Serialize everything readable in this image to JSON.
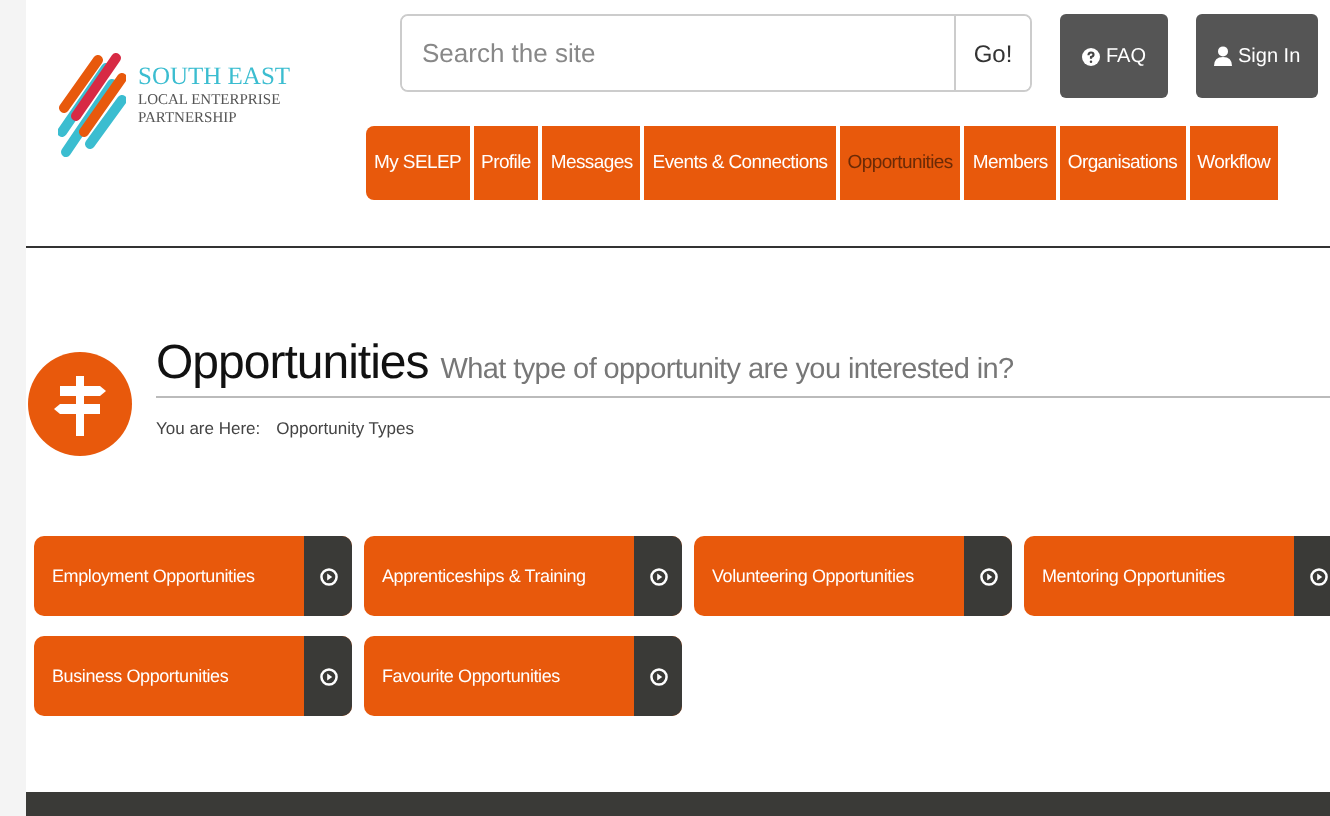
{
  "logo": {
    "line1": "SOUTH EAST",
    "line2": "LOCAL ENTERPRISE",
    "line3": "PARTNERSHIP"
  },
  "search": {
    "placeholder": "Search the site",
    "button": "Go!"
  },
  "header_buttons": [
    {
      "label": "FAQ",
      "kind": "help"
    },
    {
      "label": "Sign In",
      "kind": "user"
    }
  ],
  "nav": [
    {
      "label": "My SELEP",
      "selected": false
    },
    {
      "label": "Profile",
      "selected": false
    },
    {
      "label": "Messages",
      "selected": false
    },
    {
      "label": "Events & Connections",
      "selected": false
    },
    {
      "label": "Opportunities",
      "selected": true
    },
    {
      "label": "Members",
      "selected": false
    },
    {
      "label": "Organisations",
      "selected": false
    },
    {
      "label": "Workflow",
      "selected": false
    }
  ],
  "page": {
    "title": "Opportunities",
    "subtitle": "What type of opportunity are you interested in?",
    "breadcrumb_label": "You are Here:",
    "breadcrumb": "Opportunity Types"
  },
  "tiles": [
    "Employment Opportunities",
    "Apprenticeships & Training",
    "Volunteering Opportunities",
    "Mentoring Opportunities",
    "Business Opportunities",
    "Favourite Opportunities"
  ]
}
